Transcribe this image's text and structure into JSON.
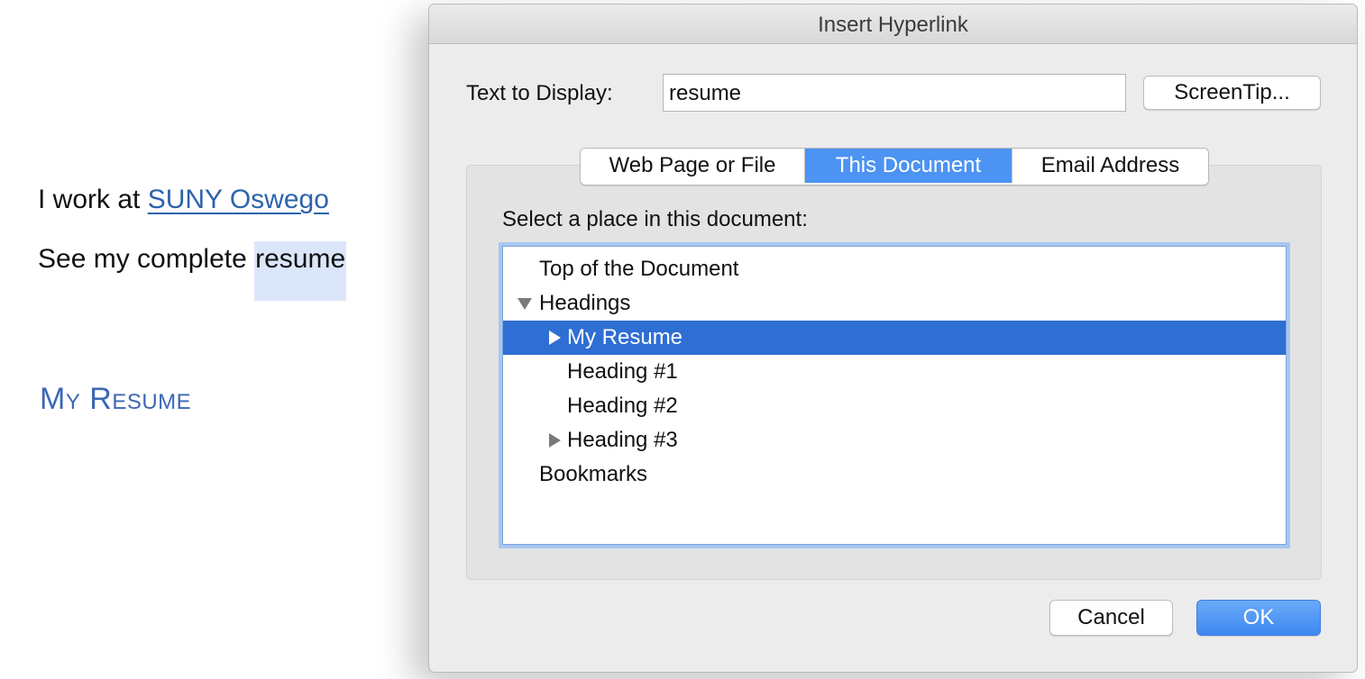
{
  "document": {
    "line1_prefix": "I work at ",
    "line1_link": "SUNY Oswego",
    "line2_prefix": "See my complete ",
    "line2_selected": "resume",
    "heading": "My Resume"
  },
  "dialog": {
    "title": "Insert Hyperlink",
    "text_to_display_label": "Text to Display:",
    "text_to_display_value": "resume",
    "screentip_label": "ScreenTip...",
    "tabs": [
      {
        "label": "Web Page or File",
        "selected": false
      },
      {
        "label": "This Document",
        "selected": true
      },
      {
        "label": "Email Address",
        "selected": false
      }
    ],
    "select_place_label": "Select a place in this document:",
    "tree": [
      {
        "label": "Top of the Document",
        "level": 0,
        "toggle": "none",
        "selected": false
      },
      {
        "label": "Headings",
        "level": 0,
        "toggle": "expanded",
        "selected": false
      },
      {
        "label": "My Resume",
        "level": 1,
        "toggle": "collapsed",
        "selected": true
      },
      {
        "label": "Heading #1",
        "level": 1,
        "toggle": "none",
        "selected": false
      },
      {
        "label": "Heading #2",
        "level": 1,
        "toggle": "none",
        "selected": false
      },
      {
        "label": "Heading #3",
        "level": 1,
        "toggle": "collapsed",
        "selected": false
      },
      {
        "label": "Bookmarks",
        "level": 0,
        "toggle": "none",
        "selected": false
      }
    ],
    "cancel_label": "Cancel",
    "ok_label": "OK"
  },
  "colors": {
    "link": "#2c64ab",
    "heading": "#3c68b6",
    "selection_bg": "#dbe6fa",
    "tab_selected": "#4c93f3",
    "tree_selected": "#2f6ed3",
    "ok_button": "#3d88f1"
  },
  "icons": {
    "expanded": "disclosure-triangle-down-icon",
    "collapsed": "disclosure-triangle-right-icon"
  }
}
